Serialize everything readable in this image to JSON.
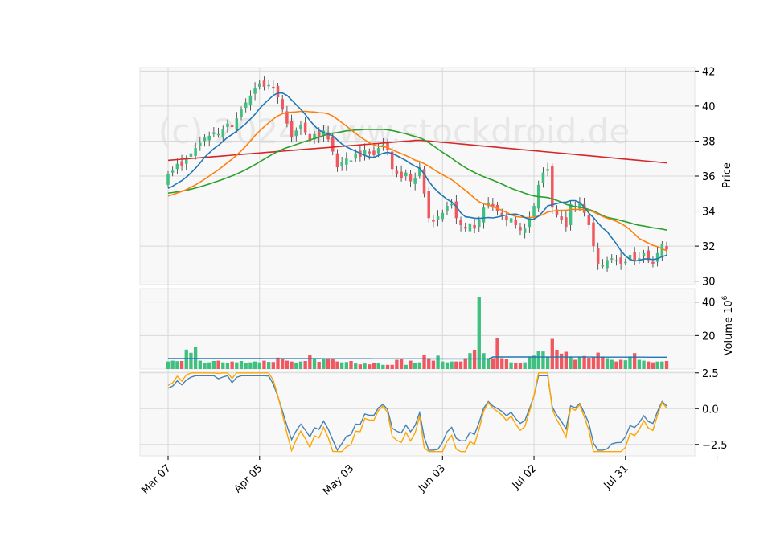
{
  "watermark": "(c) 2024 www.stockdroid.de",
  "colors": {
    "up": "#40c080",
    "down": "#f05860",
    "panel_bg": "#f8f8f8",
    "grid": "#d8d8d8",
    "ma_fast": "#1f77b4",
    "ma_mid": "#ff7f0e",
    "ma_slow": "#2ca02c",
    "ma_long": "#d62728",
    "osc_1": "#4682b4",
    "osc_2": "#ffa500",
    "vol_avg": "#1f77b4"
  },
  "chart_data": [
    {
      "type": "candlestick",
      "panel": "price",
      "ylabel": "Price",
      "ylim": [
        29.8,
        42.2
      ],
      "yticks": [
        30,
        32,
        34,
        36,
        38,
        40,
        42
      ],
      "grid": true,
      "y_axis_side": "right",
      "x_tick_labels": [
        "Mar 07",
        "Apr 05",
        "May 03",
        "Jun 03",
        "Jul 02",
        "Jul 31"
      ],
      "x_tick_index": [
        0,
        20,
        40,
        60,
        80,
        100
      ],
      "close": [
        36.1,
        36.3,
        36.7,
        36.6,
        37.0,
        37.3,
        37.6,
        37.9,
        38.2,
        38.3,
        38.5,
        38.4,
        38.7,
        39.0,
        38.8,
        39.3,
        39.8,
        40.2,
        40.6,
        41.0,
        41.3,
        41.1,
        41.2,
        41.0,
        40.5,
        39.8,
        39.0,
        38.2,
        38.6,
        38.9,
        38.5,
        38.0,
        38.4,
        38.2,
        38.6,
        38.1,
        37.4,
        36.5,
        36.8,
        37.0,
        36.9,
        37.3,
        37.1,
        37.5,
        37.3,
        37.2,
        37.6,
        37.8,
        37.5,
        36.4,
        36.1,
        35.9,
        36.2,
        35.7,
        35.9,
        36.5,
        35.0,
        33.6,
        33.4,
        33.7,
        33.9,
        34.3,
        34.4,
        33.6,
        33.2,
        33.0,
        33.3,
        33.0,
        33.5,
        34.2,
        34.5,
        34.2,
        34.0,
        33.8,
        33.5,
        33.6,
        33.2,
        32.9,
        33.0,
        33.6,
        34.3,
        35.5,
        36.2,
        36.4,
        34.2,
        33.8,
        33.5,
        33.1,
        34.4,
        34.3,
        34.5,
        33.9,
        33.2,
        32.0,
        31.0,
        30.9,
        31.2,
        31.3,
        31.2,
        31.0,
        31.1,
        31.5,
        31.2,
        31.3,
        31.6,
        31.2,
        31.0,
        31.6,
        32.1,
        31.8
      ],
      "volume_scale": "10^6",
      "volume": [
        4.5,
        5,
        4.7,
        4.8,
        11.6,
        9.7,
        13,
        5,
        3.5,
        4,
        4.8,
        5,
        4,
        3.5,
        4.5,
        4,
        4.8,
        3.8,
        4,
        4.5,
        4,
        5,
        4.3,
        4.2,
        6.8,
        6.5,
        5,
        4.5,
        3.7,
        4.5,
        4.8,
        8.5,
        6.5,
        4.3,
        5.8,
        6.5,
        6.2,
        4.5,
        4,
        4.2,
        4.8,
        3.3,
        2.8,
        3.3,
        2.8,
        3.8,
        3.5,
        2.5,
        2.5,
        2.5,
        5.5,
        6,
        2.5,
        5,
        3.7,
        4,
        8.3,
        6.5,
        5,
        8,
        4.5,
        4,
        4.5,
        4.5,
        4.5,
        6.5,
        9.5,
        11.5,
        43,
        9.5,
        6.5,
        6.5,
        18.5,
        6.5,
        6.2,
        4,
        3.8,
        3.5,
        4,
        7,
        8,
        10.8,
        10.5,
        7.5,
        18,
        11.5,
        9.2,
        10.3,
        7.5,
        5.5,
        7.5,
        7.8,
        6.7,
        7,
        9.8,
        7.5,
        6.5,
        5.5,
        4.5,
        5.5,
        5.2,
        7.5,
        9.5,
        5.5,
        5,
        4.5,
        4,
        4.5,
        4.5,
        4.8
      ],
      "volume_ylim": [
        0,
        48
      ],
      "volume_yticks": [
        20,
        40
      ],
      "volume_ylabel": "Volume  $10^6$"
    },
    {
      "type": "line",
      "panel": "oscillator",
      "ylim": [
        -3.3,
        2.6
      ],
      "yticks": [
        -2.5,
        0.0,
        2.5
      ],
      "ytick_labels": [
        "−2.5",
        "0.0",
        "2.5"
      ],
      "grid": true
    }
  ]
}
